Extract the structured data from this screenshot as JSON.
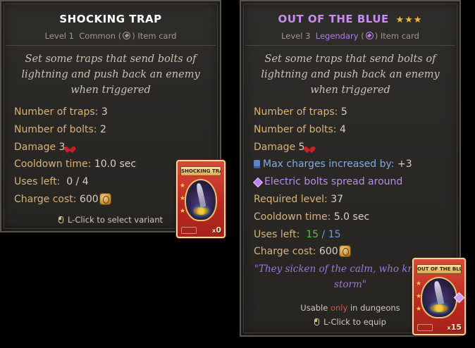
{
  "left_card": {
    "title": "SHOCKING TRAP",
    "title_color": "#ffffff",
    "subtitle": {
      "level": "Level 1",
      "rarity": "Common",
      "rarity_color": "#a09a8c",
      "type": "Item card"
    },
    "description": "Set some traps that send bolts of lightning and push back an enemy when triggered",
    "stats": {
      "traps_label": "Number of traps:",
      "traps_value": "3",
      "bolts_label": "Number of bolts:",
      "bolts_value": "2",
      "damage_label": "Damage",
      "damage_value": "3",
      "cooldown_label": "Cooldown time:",
      "cooldown_value": "10.0 sec",
      "uses_label": "Uses left:",
      "uses_value": "0 / 4",
      "charge_label": "Charge cost:",
      "charge_value": "600"
    },
    "footer": "L-Click to select variant",
    "card_banner": "SHOCKING TRAP",
    "card_count": "0",
    "card_count_prefix": "x"
  },
  "right_card": {
    "title": "OUT OF THE BLUE",
    "title_color": "#c98cf2",
    "stars": "★★★",
    "subtitle": {
      "level": "Level 3",
      "rarity": "Legendary",
      "rarity_color": "#b07ee8",
      "type": "Item card"
    },
    "description": "Set some traps that send bolts of lightning and push back an enemy when triggered",
    "stats": {
      "traps_label": "Number of traps:",
      "traps_value": "5",
      "bolts_label": "Number of bolts:",
      "bolts_value": "4",
      "damage_label": "Damage",
      "damage_value": "5",
      "max_charges_label": "Max charges increased by:",
      "max_charges_value": "+3",
      "electric_label": "Electric bolts spread around",
      "required_label": "Required level:",
      "required_value": "37",
      "cooldown_label": "Cooldown time:",
      "cooldown_value": "5.0 sec",
      "uses_label": "Uses left:",
      "uses_current": "15",
      "uses_sep": "/",
      "uses_max": "15",
      "charge_label": "Charge cost:",
      "charge_value": "600"
    },
    "quote": "\"They sicken of the calm, who know the storm\"",
    "footer_usable_pre": "Usable",
    "footer_usable_only": "only",
    "footer_usable_post": "in dungeons",
    "footer_click": "L-Click to equip",
    "card_banner": "OUT OF THE BLUE",
    "card_count": "15",
    "card_count_prefix": "x"
  },
  "icons": {
    "damage": "heart-icon",
    "charge": "rune-coin-icon",
    "mouse": "mouse-icon",
    "max_charges": "charge-badge-icon",
    "electric": "purple-gem-icon",
    "rarity": "diamond-gem-icon"
  }
}
